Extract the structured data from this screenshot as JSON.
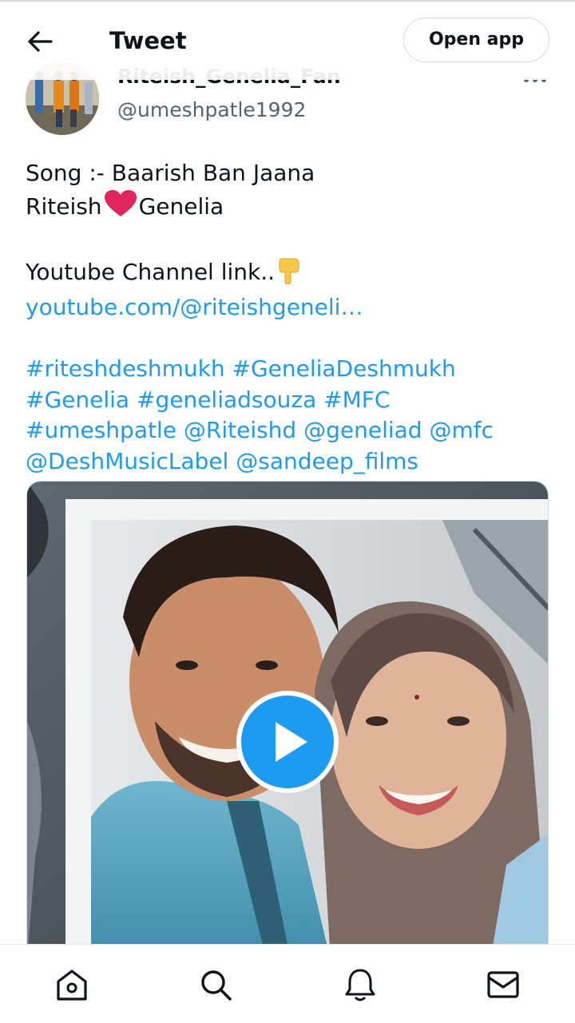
{
  "header": {
    "title": "Tweet",
    "open_app_label": "Open app",
    "back_icon": "arrow-left-icon"
  },
  "tweet": {
    "author_name": "Riteish_Genelia_Fan",
    "handle": "@umeshpatle1992",
    "more_icon": "ellipsis-icon",
    "song_line": "Song :- Baarish Ban Jaana",
    "name_left": "Riteish",
    "name_right": "Genelia",
    "channel_text": "Youtube Channel link..",
    "link": "youtube.com/@riteishgeneli…",
    "tags": {
      "t1": "#riteshdeshmukh",
      "t2": "#GeneliaDeshmukh",
      "t3": "#Genelia",
      "t4": "#geneliadsouza",
      "t5": "#MFC",
      "t6": "#umeshpatle",
      "m1": "@Riteishd",
      "m2": "@geneliad",
      "m3": "@mfc",
      "m4": "@DeshMusicLabel",
      "m5": "@sandeep_films"
    }
  },
  "media": {
    "type": "video",
    "play_icon": "play-icon"
  },
  "bottom_nav": [
    "home-icon",
    "search-icon",
    "notifications-bell-icon",
    "messages-mail-icon"
  ],
  "colors": {
    "link_blue": "#1d9bf0",
    "play_button": "#1d9bf0",
    "heart": "#e0245e",
    "secondary_text": "#536471"
  }
}
